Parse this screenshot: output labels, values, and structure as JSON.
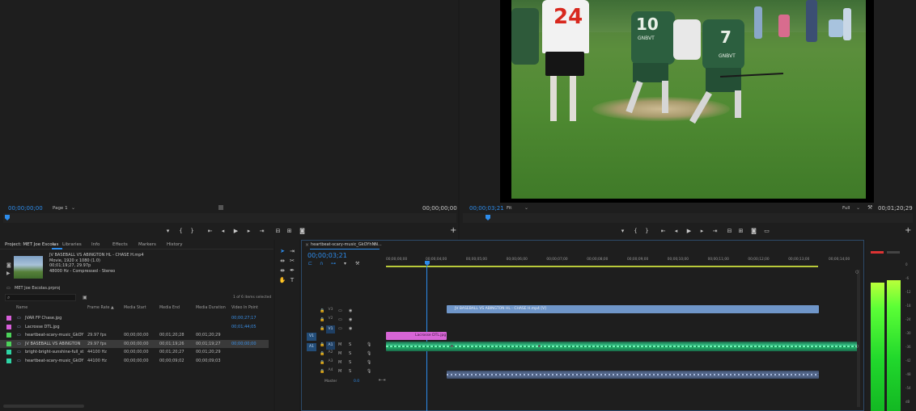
{
  "source_monitor": {
    "timecode_in": "00;00;00;00",
    "page_label": "Page 1",
    "timecode_right": "00;00;00;00"
  },
  "program_monitor": {
    "timecode": "00;00;03;21",
    "fit_label": "Fit",
    "quality_label": "Full",
    "duration": "00;01;20;29"
  },
  "video": {
    "jersey_numbers": [
      "24",
      "10",
      "7"
    ],
    "jersey_text": [
      "GNBVT",
      "GNBVT"
    ]
  },
  "project_panel": {
    "tabs": [
      "Project: MET Joe Escolas",
      "Libraries",
      "Info",
      "Effects",
      "Markers",
      "History"
    ],
    "preview": {
      "title": "JV BASEBALL VS ABINGTON HL - CHASE H.mp4",
      "line1": "Movie, 1920 x 1080 (1.0)",
      "line2": "00;01;19;27, 29.97p",
      "line3": "48000 Hz - Compressed - Stereo"
    },
    "project_file": "MET Joe Escolas.prproj",
    "items_selected": "1 of 6 items selected",
    "columns": [
      "Name",
      "Frame Rate",
      "Media Start",
      "Media End",
      "Media Duration",
      "Video In Point"
    ],
    "rows": [
      {
        "name": "JVAR FP Chase.jpg",
        "frame_rate": "",
        "media_start": "",
        "media_end": "",
        "media_duration": "",
        "video_in": "00;00;27;17",
        "color": "#d65fd9"
      },
      {
        "name": "Lacrosse DTL.jpg",
        "frame_rate": "",
        "media_start": "",
        "media_end": "",
        "media_duration": "",
        "video_in": "00;01;44;05",
        "color": "#d65fd9"
      },
      {
        "name": "heartbeat-scary-music_GkOY",
        "frame_rate": "29.97 fps",
        "media_start": "00;00;00;00",
        "media_end": "00;01;20;28",
        "media_duration": "00;01;20;29",
        "video_in": "",
        "color": "#4cd35a"
      },
      {
        "name": "JV BASEBALL VS ABINGTON",
        "frame_rate": "29.97 fps",
        "media_start": "00;00;00;00",
        "media_end": "00;01;19;26",
        "media_duration": "00;01;19;27",
        "video_in": "00;00;00;00",
        "color": "#4cd35a",
        "selected": true
      },
      {
        "name": "bright-bright-sunshine-full_st",
        "frame_rate": "44100 Hz",
        "media_start": "00;00;00;00",
        "media_end": "00;01;20;27",
        "media_duration": "00;01;20;29",
        "video_in": "",
        "color": "#2ed4a5"
      },
      {
        "name": "heartbeat-scary-music_GkOY",
        "frame_rate": "44100 Hz",
        "media_start": "00;00;00;00",
        "media_end": "00;00;09;02",
        "media_duration": "00;00;09;03",
        "video_in": "",
        "color": "#2ed4a5"
      }
    ]
  },
  "timeline": {
    "sequence_name": "heartbeat-scary-music_GkOYhNN...",
    "timecode": "00;00;03;21",
    "ruler": [
      "00;00;00;00",
      "00;00;04;00",
      "00;00;05;00",
      "00;00;06;00",
      "00;00;07;00",
      "00;00;08;00",
      "00;00;09;00",
      "00;00;10;00",
      "00;00;11;00",
      "00;00;12;00",
      "00;00;13;00",
      "00;00;14;00"
    ],
    "video_tracks": [
      "V3",
      "V2",
      "V1"
    ],
    "audio_tracks": [
      "A1",
      "A2",
      "A3",
      "A4"
    ],
    "source_patch": [
      "V1",
      "A1"
    ],
    "master_label": "Master",
    "master_value": "0.0",
    "clips": {
      "v2_video": "JV BASEBALL VS ABINGTON HL - CHASE H.mp4 [V]",
      "v1_image": "Lacrosse DTL.jpg"
    }
  },
  "audio_meters": {
    "db_labels": [
      "0",
      "-6",
      "-12",
      "-18",
      "-24",
      "-30",
      "-36",
      "-42",
      "-48",
      "-54",
      "dB"
    ]
  }
}
